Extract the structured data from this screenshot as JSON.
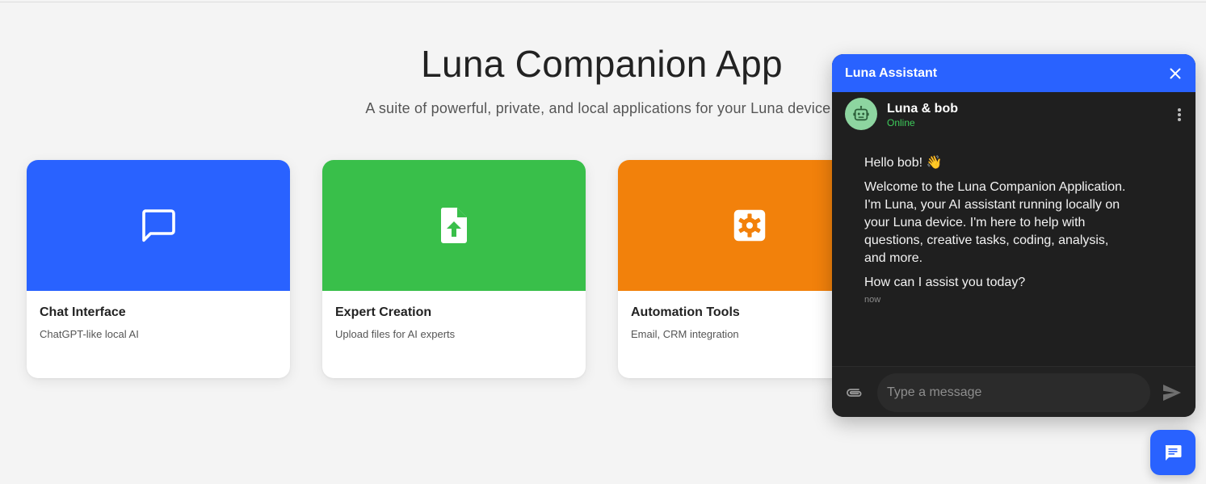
{
  "colors": {
    "accent_blue": "#2962ff",
    "accent_green": "#39bf4a",
    "accent_orange": "#f2810b",
    "online_green": "#3ecb5b",
    "avatar_bg": "#8dd5a0"
  },
  "hero": {
    "title": "Luna Companion App",
    "subtitle": "A suite of powerful, private, and local applications for your Luna device."
  },
  "cards": [
    {
      "title": "Chat Interface",
      "description": "ChatGPT-like local AI",
      "icon": "chat-bubble-icon"
    },
    {
      "title": "Expert Creation",
      "description": "Upload files for AI experts",
      "icon": "file-upload-icon"
    },
    {
      "title": "Automation Tools",
      "description": "Email, CRM integration",
      "icon": "settings-gear-icon"
    }
  ],
  "chat": {
    "header_title": "Luna Assistant",
    "contact_name": "Luna & bob",
    "contact_status": "Online",
    "messages": [
      "Hello bob! 👋",
      "Welcome to the Luna Companion Application. I'm Luna, your AI assistant running locally on your Luna device. I'm here to help with questions, creative tasks, coding, analysis, and more.",
      "How can I assist you today?"
    ],
    "message_time": "now",
    "input_placeholder": "Type a message"
  }
}
